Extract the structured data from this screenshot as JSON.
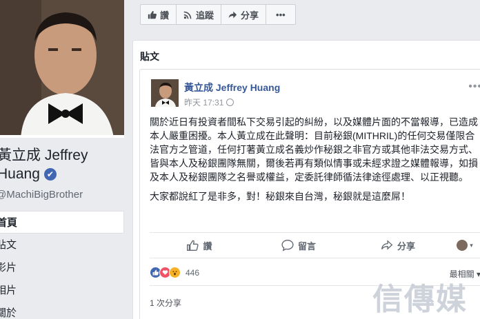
{
  "profile": {
    "name": "黃立成 Jeffrey Huang",
    "handle": "@MachiBigBrother",
    "verified_mark": "✔"
  },
  "left_nav": [
    {
      "label": "首頁",
      "active": true
    },
    {
      "label": "貼文",
      "active": false
    },
    {
      "label": "影片",
      "active": false
    },
    {
      "label": "相片",
      "active": false
    },
    {
      "label": "關於",
      "active": false
    }
  ],
  "action_bar": {
    "like_label": "讚",
    "follow_label": "追蹤",
    "share_label": "分享",
    "more_label": "•••"
  },
  "panel": {
    "title": "貼文"
  },
  "post": {
    "author": "黃立成 Jeffrey Huang",
    "time": "昨天 17:31",
    "menu": "•••",
    "paragraph1": "關於近日有投資者間私下交易引起的糾紛，以及媒體片面的不當報導，已造成本人嚴重困擾。本人黃立成在此聲明：目前秘銀(MITHRIL)的任何交易僅限合法官方之管道，任何打著黃立成名義炒作秘銀之非官方或其他非法交易方式、皆與本人及秘銀團隊無關，爾後若再有類似情事或未經求證之媒體報導，如損及本人及秘銀團隊之名譽或權益，定委託律師循法律途徑處理、以正視聽。",
    "paragraph2": "大家都說紅了是非多，對！秘銀來自台灣，秘銀就是這麼屌！",
    "actions": {
      "like": "讚",
      "comment": "留言",
      "share": "分享"
    },
    "reactions": {
      "count": "446",
      "icons": [
        "like-icon",
        "love-icon",
        "wow-icon"
      ]
    },
    "sort_label": "最相關 ▾",
    "share_count": "1 次分享"
  },
  "watermark": "信傳媒",
  "colors": {
    "fb_blue": "#4267b2",
    "link_blue": "#365899",
    "background": "#e9ebee"
  }
}
